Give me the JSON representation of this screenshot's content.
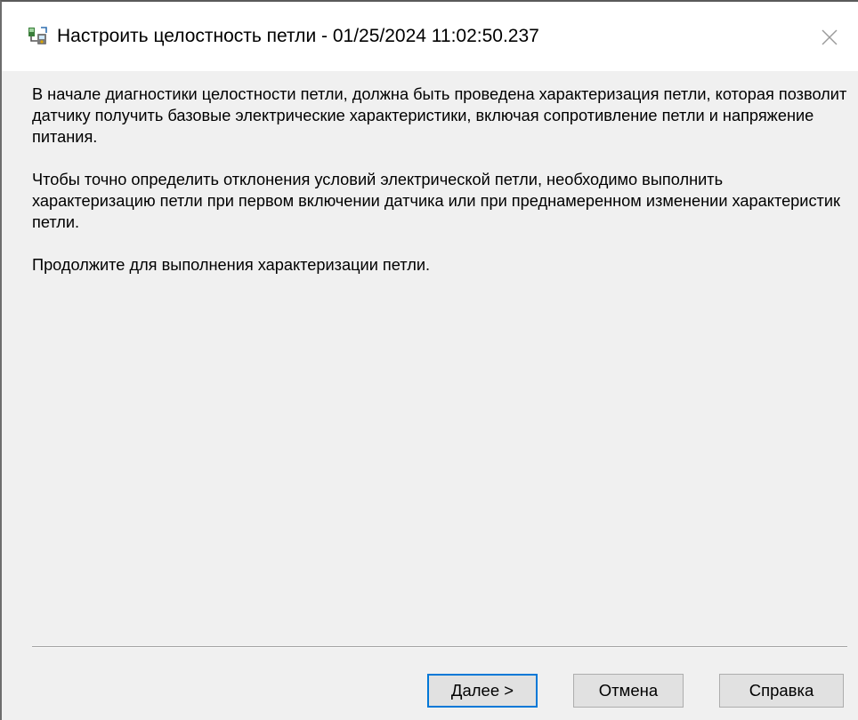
{
  "window": {
    "title": "Настроить целостность петли - 01/25/2024 11:02:50.237",
    "icon": "loop-diagnostic-app-icon",
    "close_icon": "close-icon"
  },
  "content": {
    "paragraphs": [
      "В начале диагностики целостности петли, должна быть проведена характеризация петли, которая позволит датчику получить базовые электрические характеристики, включая сопротивление петли и напряжение питания.",
      "Чтобы точно определить отклонения условий электрической петли, необходимо выполнить характеризацию петли при первом включении датчика или при преднамеренном изменении характеристик петли.",
      "Продолжите для выполнения характеризации петли."
    ]
  },
  "buttons": {
    "next": "Далее >",
    "cancel": "Отмена",
    "help": "Справка"
  },
  "colors": {
    "focus_border": "#0078d7",
    "dialog_background": "#f0f0f0",
    "titlebar_background": "#ffffff",
    "button_face": "#e1e1e1"
  }
}
